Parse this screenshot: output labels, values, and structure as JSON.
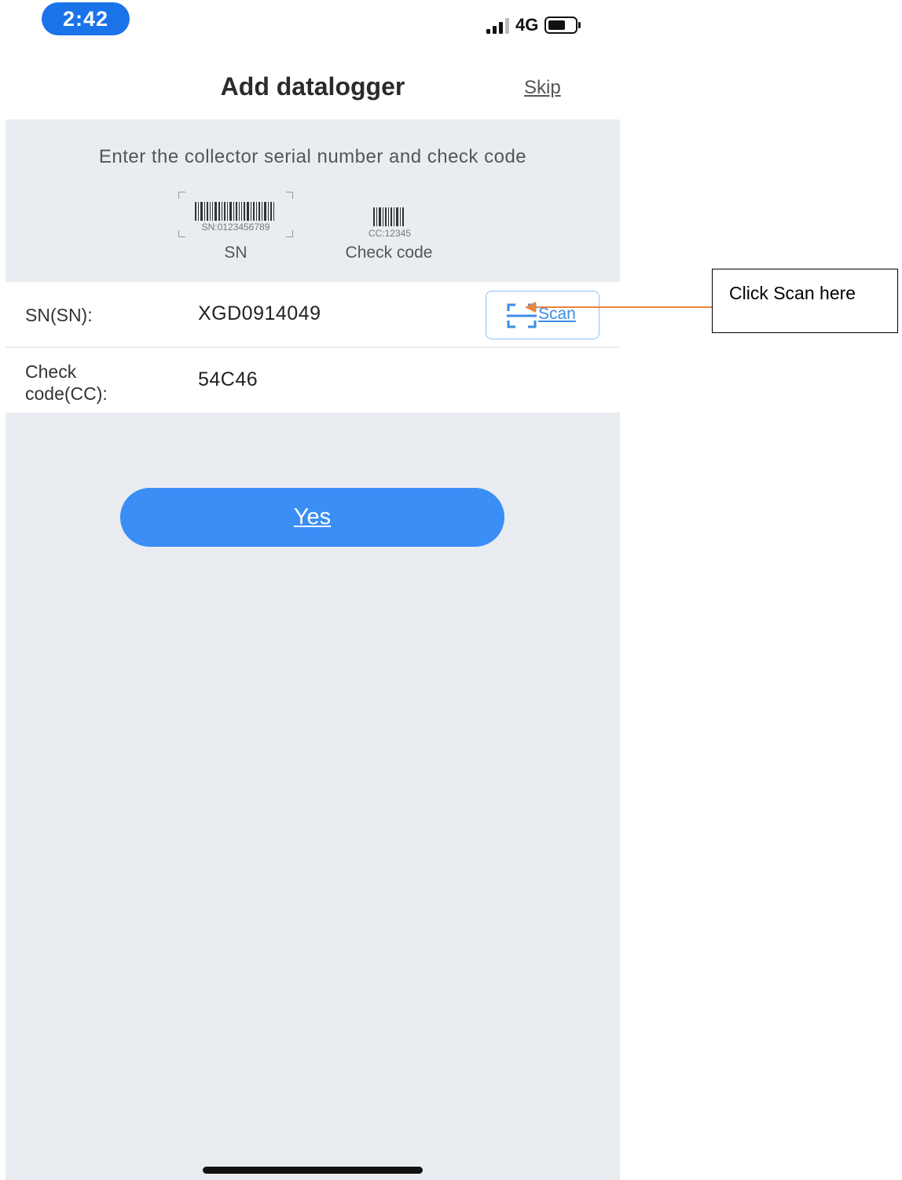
{
  "status_bar": {
    "time": "2:42",
    "network": "4G"
  },
  "header": {
    "title": "Add datalogger",
    "skip_label": "Skip"
  },
  "instructions": {
    "text": "Enter the collector serial number and check code",
    "sn_sample_text": "SN:0123456789",
    "cc_sample_text": "CC:12345",
    "sn_label": "SN",
    "cc_label": "Check code"
  },
  "form": {
    "sn_label": "SN(SN):",
    "sn_value": "XGD0914049",
    "scan_label": "Scan",
    "cc_label_line1": "Check",
    "cc_label_line2": "code(CC):",
    "cc_value": "54C46"
  },
  "actions": {
    "yes_label": "Yes"
  },
  "annotation": {
    "text": "Click Scan here"
  },
  "colors": {
    "accent": "#3a8ef6",
    "time_pill": "#1a73e8",
    "arrow": "#e8863a",
    "panel": "#e9edf1"
  }
}
